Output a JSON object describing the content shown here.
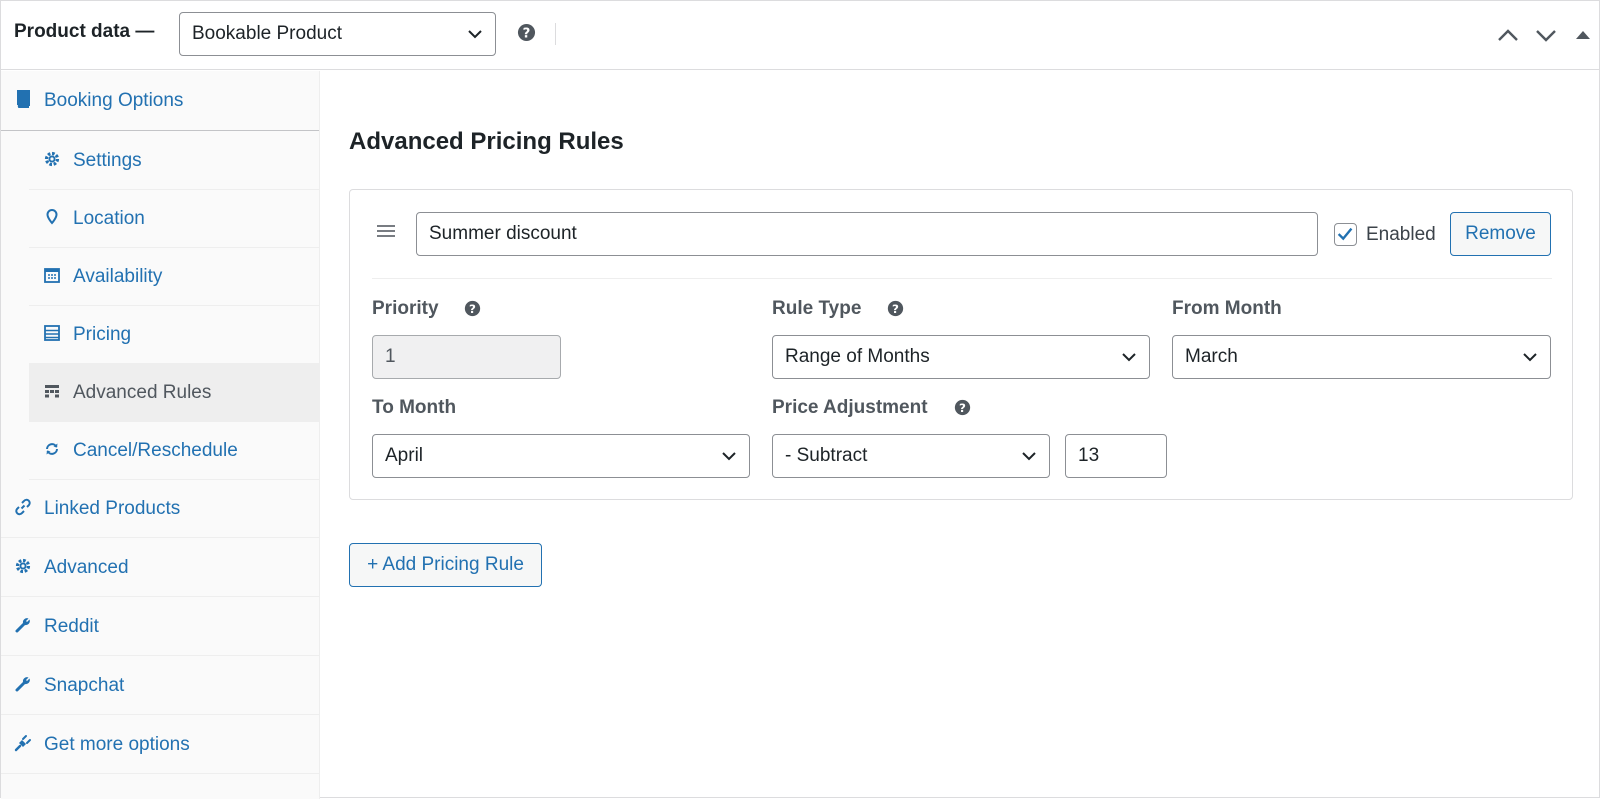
{
  "header": {
    "title": "Product data —",
    "product_type": "Bookable Product"
  },
  "sidebar": {
    "items": [
      {
        "label": "Booking Options",
        "icon": "book-icon"
      },
      {
        "label": "Settings",
        "icon": "gear-icon"
      },
      {
        "label": "Location",
        "icon": "location-pin-icon"
      },
      {
        "label": "Availability",
        "icon": "calendar-icon"
      },
      {
        "label": "Pricing",
        "icon": "list-icon"
      },
      {
        "label": "Advanced Rules",
        "icon": "table-icon",
        "active": true
      },
      {
        "label": "Cancel/Reschedule",
        "icon": "refresh-icon"
      },
      {
        "label": "Linked Products",
        "icon": "link-icon"
      },
      {
        "label": "Advanced",
        "icon": "gear-icon"
      },
      {
        "label": "Reddit",
        "icon": "wrench-icon"
      },
      {
        "label": "Snapchat",
        "icon": "wrench-icon"
      },
      {
        "label": "Get more options",
        "icon": "plugin-icon"
      }
    ]
  },
  "main": {
    "title": "Advanced Pricing Rules",
    "rule": {
      "name": "Summer discount",
      "enabled_label": "Enabled",
      "enabled": true,
      "remove_label": "Remove",
      "priority_label": "Priority",
      "priority_value": "1",
      "rule_type_label": "Rule Type",
      "rule_type_value": "Range of Months",
      "from_month_label": "From Month",
      "from_month_value": "March",
      "to_month_label": "To Month",
      "to_month_value": "April",
      "price_adjustment_label": "Price Adjustment",
      "price_adjustment_op": "- Subtract",
      "price_adjustment_amount": "13"
    },
    "add_rule_label": "+ Add Pricing Rule"
  },
  "colors": {
    "accent": "#2271b1",
    "text": "#1d2327",
    "muted": "#50575e",
    "border": "#8c8f94"
  }
}
